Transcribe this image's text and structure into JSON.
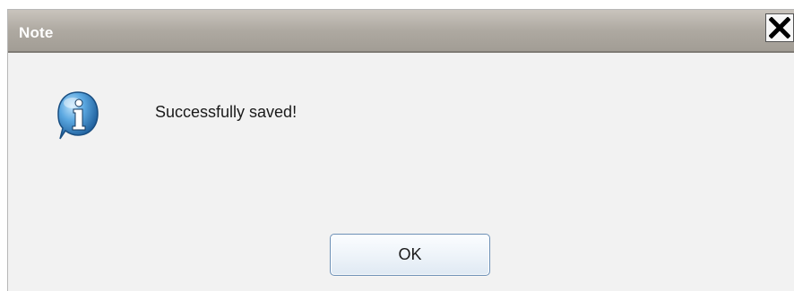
{
  "window": {
    "title": "Note",
    "close_icon": "close-icon"
  },
  "content": {
    "icon": "info-icon",
    "message": "Successfully saved!"
  },
  "actions": {
    "ok_label": "OK"
  }
}
